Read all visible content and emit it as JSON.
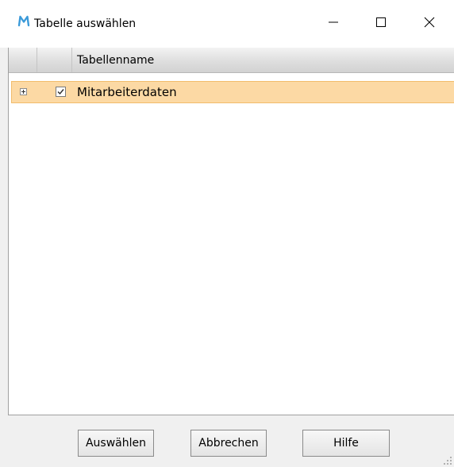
{
  "window": {
    "title": "Tabelle auswählen",
    "app_icon": "M-logo-icon",
    "accent_color": "#3b9ad9"
  },
  "grid": {
    "columns": [
      "",
      "",
      "Tabellenname"
    ],
    "rows": [
      {
        "expanded": false,
        "checked": true,
        "name": "Mitarbeiterdaten",
        "selected": true
      }
    ],
    "selection_color": "#fcd9a4"
  },
  "footer": {
    "select_label": "Auswählen",
    "cancel_label": "Abbrechen",
    "help_label": "Hilfe"
  }
}
